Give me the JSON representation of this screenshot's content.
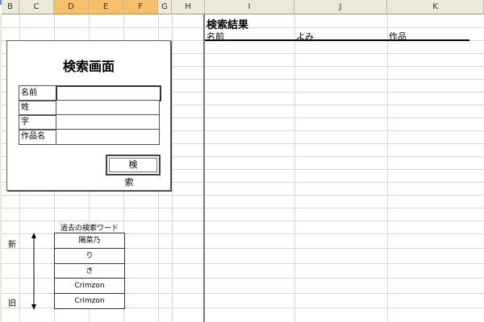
{
  "columns": {
    "B": "B",
    "C": "C",
    "D": "D",
    "E": "E",
    "F": "F",
    "G": "G",
    "H": "H",
    "I": "I",
    "J": "J",
    "K": "K"
  },
  "search_panel": {
    "title": "検索画面",
    "fields": [
      {
        "label": "名前",
        "value": ""
      },
      {
        "label": "姓",
        "value": ""
      },
      {
        "label": "字",
        "value": ""
      },
      {
        "label": "作品名",
        "value": ""
      }
    ],
    "search_button": "検　索"
  },
  "results": {
    "title": "検索結果",
    "headers": [
      "名前",
      "よみ",
      "作品"
    ]
  },
  "history": {
    "title": "過去の検索ワード",
    "newer_label": "新",
    "older_label": "旧",
    "items": [
      "陽菜乃",
      "り",
      "き",
      "Crimzon",
      "Crimzon"
    ]
  }
}
